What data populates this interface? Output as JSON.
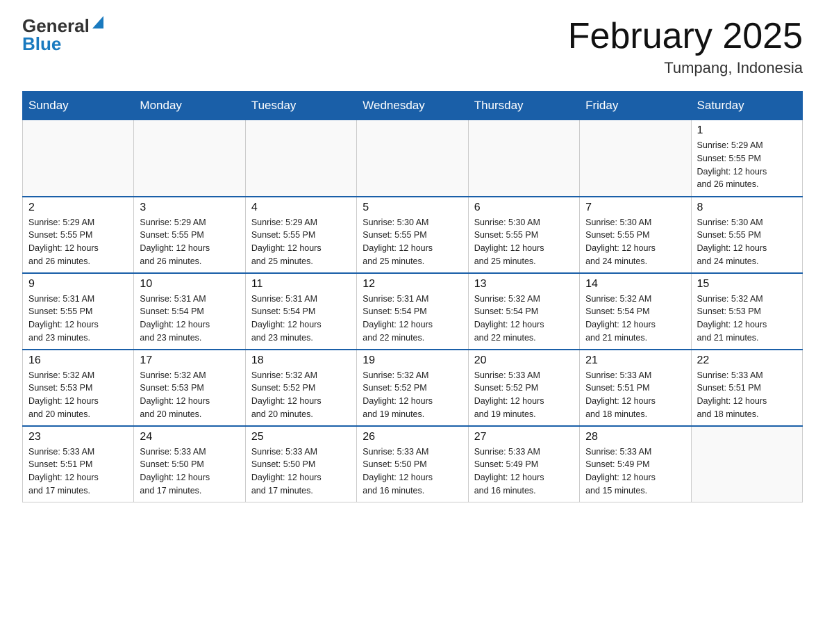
{
  "header": {
    "logo_general": "General",
    "logo_blue": "Blue",
    "title": "February 2025",
    "subtitle": "Tumpang, Indonesia"
  },
  "weekdays": [
    "Sunday",
    "Monday",
    "Tuesday",
    "Wednesday",
    "Thursday",
    "Friday",
    "Saturday"
  ],
  "weeks": [
    {
      "days": [
        {
          "number": "",
          "info": ""
        },
        {
          "number": "",
          "info": ""
        },
        {
          "number": "",
          "info": ""
        },
        {
          "number": "",
          "info": ""
        },
        {
          "number": "",
          "info": ""
        },
        {
          "number": "",
          "info": ""
        },
        {
          "number": "1",
          "info": "Sunrise: 5:29 AM\nSunset: 5:55 PM\nDaylight: 12 hours\nand 26 minutes."
        }
      ]
    },
    {
      "days": [
        {
          "number": "2",
          "info": "Sunrise: 5:29 AM\nSunset: 5:55 PM\nDaylight: 12 hours\nand 26 minutes."
        },
        {
          "number": "3",
          "info": "Sunrise: 5:29 AM\nSunset: 5:55 PM\nDaylight: 12 hours\nand 26 minutes."
        },
        {
          "number": "4",
          "info": "Sunrise: 5:29 AM\nSunset: 5:55 PM\nDaylight: 12 hours\nand 25 minutes."
        },
        {
          "number": "5",
          "info": "Sunrise: 5:30 AM\nSunset: 5:55 PM\nDaylight: 12 hours\nand 25 minutes."
        },
        {
          "number": "6",
          "info": "Sunrise: 5:30 AM\nSunset: 5:55 PM\nDaylight: 12 hours\nand 25 minutes."
        },
        {
          "number": "7",
          "info": "Sunrise: 5:30 AM\nSunset: 5:55 PM\nDaylight: 12 hours\nand 24 minutes."
        },
        {
          "number": "8",
          "info": "Sunrise: 5:30 AM\nSunset: 5:55 PM\nDaylight: 12 hours\nand 24 minutes."
        }
      ]
    },
    {
      "days": [
        {
          "number": "9",
          "info": "Sunrise: 5:31 AM\nSunset: 5:55 PM\nDaylight: 12 hours\nand 23 minutes."
        },
        {
          "number": "10",
          "info": "Sunrise: 5:31 AM\nSunset: 5:54 PM\nDaylight: 12 hours\nand 23 minutes."
        },
        {
          "number": "11",
          "info": "Sunrise: 5:31 AM\nSunset: 5:54 PM\nDaylight: 12 hours\nand 23 minutes."
        },
        {
          "number": "12",
          "info": "Sunrise: 5:31 AM\nSunset: 5:54 PM\nDaylight: 12 hours\nand 22 minutes."
        },
        {
          "number": "13",
          "info": "Sunrise: 5:32 AM\nSunset: 5:54 PM\nDaylight: 12 hours\nand 22 minutes."
        },
        {
          "number": "14",
          "info": "Sunrise: 5:32 AM\nSunset: 5:54 PM\nDaylight: 12 hours\nand 21 minutes."
        },
        {
          "number": "15",
          "info": "Sunrise: 5:32 AM\nSunset: 5:53 PM\nDaylight: 12 hours\nand 21 minutes."
        }
      ]
    },
    {
      "days": [
        {
          "number": "16",
          "info": "Sunrise: 5:32 AM\nSunset: 5:53 PM\nDaylight: 12 hours\nand 20 minutes."
        },
        {
          "number": "17",
          "info": "Sunrise: 5:32 AM\nSunset: 5:53 PM\nDaylight: 12 hours\nand 20 minutes."
        },
        {
          "number": "18",
          "info": "Sunrise: 5:32 AM\nSunset: 5:52 PM\nDaylight: 12 hours\nand 20 minutes."
        },
        {
          "number": "19",
          "info": "Sunrise: 5:32 AM\nSunset: 5:52 PM\nDaylight: 12 hours\nand 19 minutes."
        },
        {
          "number": "20",
          "info": "Sunrise: 5:33 AM\nSunset: 5:52 PM\nDaylight: 12 hours\nand 19 minutes."
        },
        {
          "number": "21",
          "info": "Sunrise: 5:33 AM\nSunset: 5:51 PM\nDaylight: 12 hours\nand 18 minutes."
        },
        {
          "number": "22",
          "info": "Sunrise: 5:33 AM\nSunset: 5:51 PM\nDaylight: 12 hours\nand 18 minutes."
        }
      ]
    },
    {
      "days": [
        {
          "number": "23",
          "info": "Sunrise: 5:33 AM\nSunset: 5:51 PM\nDaylight: 12 hours\nand 17 minutes."
        },
        {
          "number": "24",
          "info": "Sunrise: 5:33 AM\nSunset: 5:50 PM\nDaylight: 12 hours\nand 17 minutes."
        },
        {
          "number": "25",
          "info": "Sunrise: 5:33 AM\nSunset: 5:50 PM\nDaylight: 12 hours\nand 17 minutes."
        },
        {
          "number": "26",
          "info": "Sunrise: 5:33 AM\nSunset: 5:50 PM\nDaylight: 12 hours\nand 16 minutes."
        },
        {
          "number": "27",
          "info": "Sunrise: 5:33 AM\nSunset: 5:49 PM\nDaylight: 12 hours\nand 16 minutes."
        },
        {
          "number": "28",
          "info": "Sunrise: 5:33 AM\nSunset: 5:49 PM\nDaylight: 12 hours\nand 15 minutes."
        },
        {
          "number": "",
          "info": ""
        }
      ]
    }
  ]
}
